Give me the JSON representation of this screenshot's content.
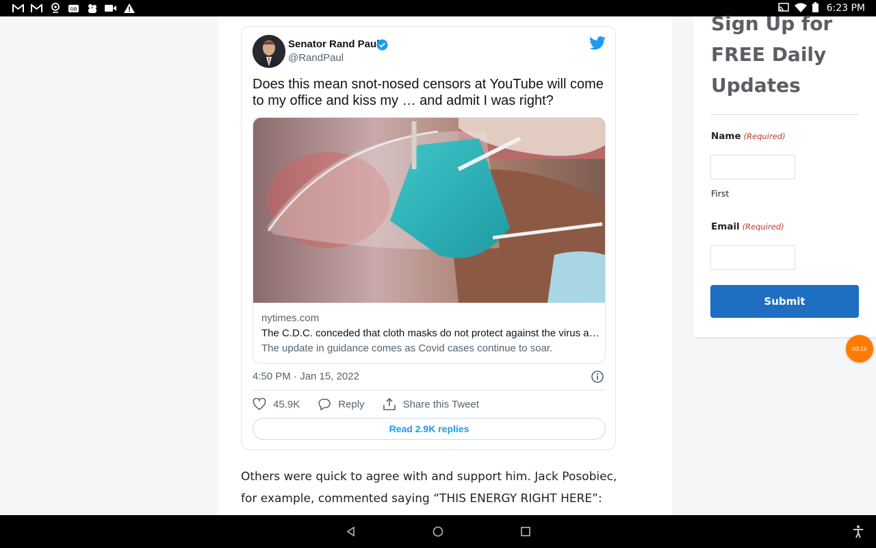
{
  "status_bar": {
    "left_icons": [
      "gmail-icon",
      "gmail-icon",
      "location-icon",
      "news-icon",
      "teams-icon",
      "video-icon",
      "alert-icon"
    ],
    "right_icons": [
      "cast-icon",
      "wifi-icon",
      "battery-icon"
    ],
    "time": "6:23 PM"
  },
  "tweet": {
    "author_name": "Senator Rand Paul",
    "author_handle": "@RandPaul",
    "text": "Does this mean snot-nosed censors at YouTube will come to my office and kiss my … and admit I was right?",
    "link_card": {
      "domain": "nytimes.com",
      "title": "The C.D.C. conceded that cloth masks do not protect against the virus a…",
      "description": "The update in guidance comes as Covid cases continue to soar."
    },
    "timestamp": "4:50 PM · Jan 15, 2022",
    "like_count": "45.9K",
    "reply_label": "Reply",
    "share_label": "Share this Tweet",
    "read_replies_label": "Read 2.9K replies"
  },
  "article": {
    "paragraph": "Others were quick to agree with and support him. Jack Posobiec, for example, commented saying “THIS ENERGY RIGHT HERE”:"
  },
  "signup_widget": {
    "title": "Sign Up for FREE Daily Updates",
    "name_label": "Name",
    "name_required": "(Required)",
    "first_sublabel": "First",
    "email_label": "Email",
    "email_required": "(Required)",
    "submit_label": "Submit"
  },
  "timer_badge": "00:15",
  "colors": {
    "twitter_blue": "#1d9bf0",
    "submit_blue": "#1e6ec2",
    "required_red": "#c0392b",
    "timer_orange": "#ff7a00"
  }
}
